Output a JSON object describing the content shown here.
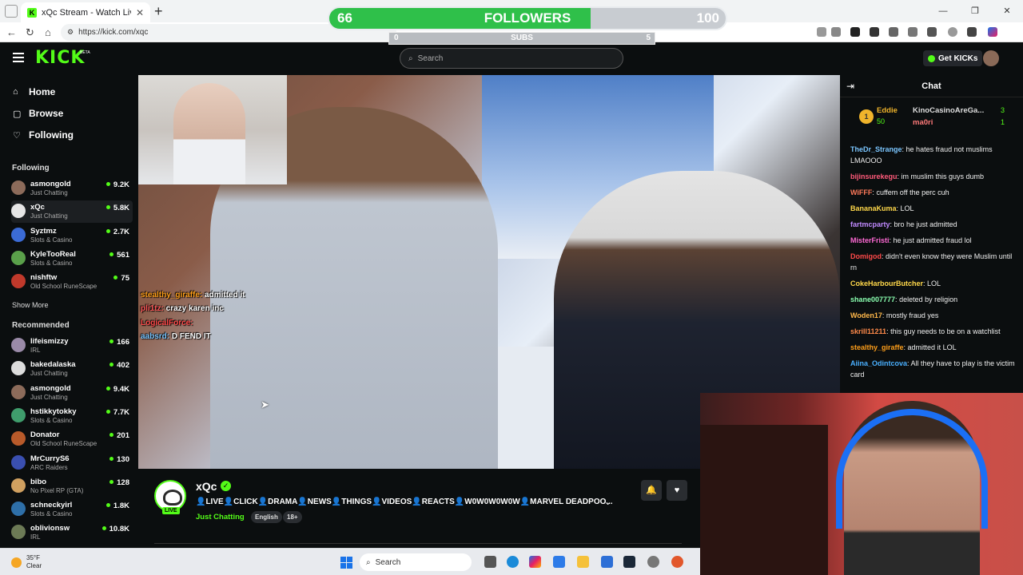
{
  "browser": {
    "tab_title": "xQc Stream - Watch Live on K",
    "url": "https://kick.com/xqc"
  },
  "overlay": {
    "goal_start": "66",
    "goal_label": "FOLLOWERS",
    "goal_end": "100",
    "goal_progress": 0.66,
    "subs_start": "0",
    "subs_label": "SUBS",
    "subs_end": "5"
  },
  "header": {
    "logo": "KICK",
    "logo_tag": "BETA",
    "search_placeholder": "Search",
    "get_kicks": "Get KICKs"
  },
  "nav": {
    "home": "Home",
    "browse": "Browse",
    "following": "Following"
  },
  "sidebar": {
    "following_title": "Following",
    "following": [
      {
        "name": "asmongold",
        "category": "Just Chatting",
        "viewers": "9.2K",
        "color": "#8c6b5a"
      },
      {
        "name": "xQc",
        "category": "Just Chatting",
        "viewers": "5.8K",
        "color": "#e6e6e6"
      },
      {
        "name": "Syztmz",
        "category": "Slots & Casino",
        "viewers": "2.7K",
        "color": "#3b6bd6"
      },
      {
        "name": "KyleTooReal",
        "category": "Slots & Casino",
        "viewers": "561",
        "color": "#5aa04a"
      },
      {
        "name": "nishftw",
        "category": "Old School RuneScape",
        "viewers": "75",
        "color": "#c0392b"
      }
    ],
    "show_more": "Show More",
    "recommended_title": "Recommended",
    "recommended": [
      {
        "name": "lifeismizzy",
        "category": "IRL",
        "viewers": "166",
        "color": "#9a8aa8"
      },
      {
        "name": "bakedalaska",
        "category": "Just Chatting",
        "viewers": "402",
        "color": "#ddd"
      },
      {
        "name": "asmongold",
        "category": "Just Chatting",
        "viewers": "9.4K",
        "color": "#8c6b5a"
      },
      {
        "name": "hstikkytokky",
        "category": "Slots & Casino",
        "viewers": "7.7K",
        "color": "#3f9d6c"
      },
      {
        "name": "Donator",
        "category": "Old School RuneScape",
        "viewers": "201",
        "color": "#b85a2a"
      },
      {
        "name": "MrCurryS6",
        "category": "ARC Raiders",
        "viewers": "130",
        "color": "#3a4fb0"
      },
      {
        "name": "bibo",
        "category": "No Pixel RP (GTA)",
        "viewers": "128",
        "color": "#d0a060"
      },
      {
        "name": "schneckyirl",
        "category": "Slots & Casino",
        "viewers": "1.8K",
        "color": "#2e6fa8"
      },
      {
        "name": "oblivionsw",
        "category": "IRL",
        "viewers": "10.8K",
        "color": "#6c7a55"
      }
    ]
  },
  "video_overlay_chat": [
    {
      "user": "stealthy_giraffe:",
      "text": "admitted it"
    },
    {
      "user": "pli1tz:",
      "text": "crazy karen inc"
    },
    {
      "user": "LogicalForce:",
      "text": ""
    },
    {
      "user": "aabsrd:",
      "text": "D FEND IT"
    },
    {
      "user": "",
      "text": ""
    }
  ],
  "stream": {
    "name": "xQc",
    "live": "LIVE",
    "title": "👤LIVE👤CLICK👤DRAMA👤NEWS👤THINGS👤VIDEOS👤REACTS👤W0W0W0W0W👤MARVEL DEADPOO...",
    "category": "Just Chatting",
    "tags": [
      "English",
      "18+"
    ]
  },
  "chat": {
    "title": "Chat",
    "gifters": {
      "rank": "1",
      "top_user": "Eddie",
      "top_value": "50",
      "user2": "KinoCasinoAreGa...",
      "user2_value": "3",
      "user3": "ma0ri",
      "user3_value": "1"
    },
    "messages": [
      {
        "user": "TheDr_Strange",
        "text": "he hates fraud not muslims LMAOOO",
        "color": "#7bc6ff"
      },
      {
        "user": "bijinsurekegu",
        "text": "im muslim this guys dumb",
        "color": "#ff5a7a"
      },
      {
        "user": "WiFFF",
        "text": "cuffem off the perc cuh",
        "color": "#ff7a5a"
      },
      {
        "user": "BananaKuma",
        "text": "LOL",
        "color": "#ffd84a"
      },
      {
        "user": "fartmcparty",
        "text": "bro he just admitted",
        "color": "#c08aff"
      },
      {
        "user": "MisterFristi",
        "text": "he just admitted fraud lol",
        "color": "#ff6ad5"
      },
      {
        "user": "Domigod",
        "text": "didn't even know they were Muslim until rn",
        "color": "#ff4a4a"
      },
      {
        "user": "CokeHarbourButcher",
        "text": "LOL",
        "color": "#ffd84a"
      },
      {
        "user": "shane007777",
        "text": "deleted by religion",
        "color": "#8affb0"
      },
      {
        "user": "Woden17",
        "text": "mostly fraud yes",
        "color": "#ffb84a"
      },
      {
        "user": "skrill11211",
        "text": "this guy needs to be on a watchlist",
        "color": "#ff8a4a"
      },
      {
        "user": "stealthy_giraffe",
        "text": "admitted it LOL",
        "color": "#ff9f1a"
      },
      {
        "user": "Aiina_Odintcova",
        "text": "All they have to play is the victim card",
        "color": "#4ab0ff"
      }
    ]
  },
  "taskbar": {
    "temp": "35°F",
    "condition": "Clear",
    "search": "Search"
  }
}
